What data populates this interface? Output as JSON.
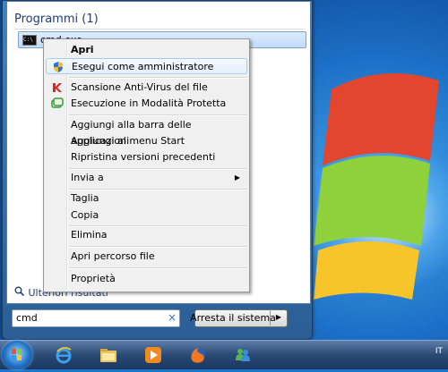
{
  "start_menu": {
    "section_header": "Programmi (1)",
    "result": {
      "label": "cmd.exe",
      "icon": "cmd-icon"
    },
    "more_results": "Ulteriori risultati",
    "search_value": "cmd",
    "search_clear": "×",
    "shutdown_label": "Arresta il sistema",
    "shutdown_arrow": "▶"
  },
  "context_menu": {
    "items": [
      {
        "label": "Apri"
      },
      {
        "label": "Esegui come amministratore",
        "icon": "uac-shield-icon"
      },
      {
        "label": "Scansione Anti-Virus del file",
        "icon": "antivirus-icon"
      },
      {
        "label": "Esecuzione in Modalità Protetta",
        "icon": "sandbox-icon"
      },
      {
        "label": "Aggiungi alla barra delle applicazioni"
      },
      {
        "label": "Aggiungi al menu Start"
      },
      {
        "label": "Ripristina versioni precedenti"
      },
      {
        "label": "Invia a",
        "submenu_arrow": "▶"
      },
      {
        "label": "Taglia"
      },
      {
        "label": "Copia"
      },
      {
        "label": "Elimina"
      },
      {
        "label": "Apri percorso file"
      },
      {
        "label": "Proprietà"
      }
    ]
  },
  "taskbar": {
    "icons": [
      "start-orb-icon",
      "internet-explorer-icon",
      "file-explorer-icon",
      "media-player-icon",
      "firefox-icon",
      "messenger-icon"
    ],
    "locale": "IT"
  },
  "colors": {
    "accent": "#1e3d73",
    "highlight": "#a8cbf1",
    "desktop": "#1a74c9"
  }
}
